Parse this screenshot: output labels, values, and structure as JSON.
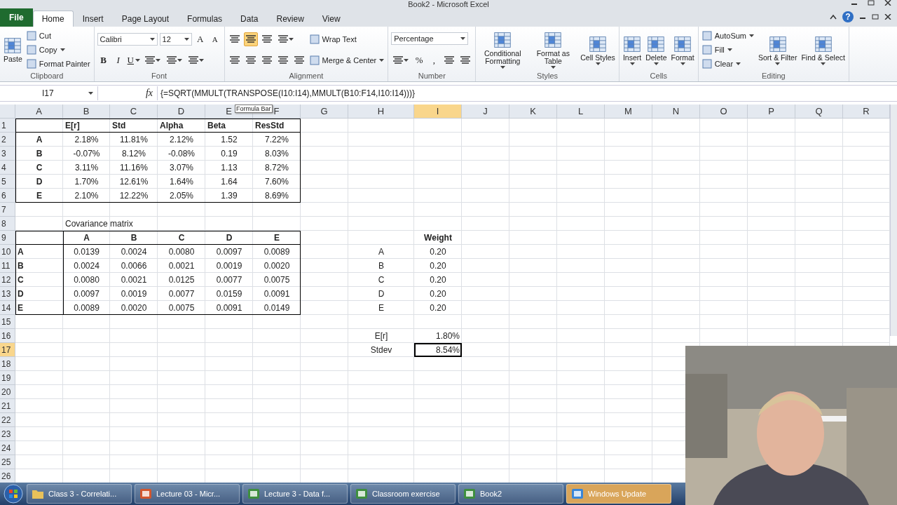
{
  "window": {
    "title": "Book2 - Microsoft Excel",
    "help": "?"
  },
  "tabs": [
    {
      "label": "File",
      "kind": "file",
      "selected": false
    },
    {
      "label": "Home",
      "kind": "tab",
      "selected": true
    },
    {
      "label": "Insert",
      "kind": "tab",
      "selected": false
    },
    {
      "label": "Page Layout",
      "kind": "tab",
      "selected": false
    },
    {
      "label": "Formulas",
      "kind": "tab",
      "selected": false
    },
    {
      "label": "Data",
      "kind": "tab",
      "selected": false
    },
    {
      "label": "Review",
      "kind": "tab",
      "selected": false
    },
    {
      "label": "View",
      "kind": "tab",
      "selected": false
    }
  ],
  "ribbon": [
    {
      "label": "Clipboard",
      "stacks": [
        [
          {
            "kind": "big",
            "label": "Paste"
          }
        ],
        [
          {
            "kind": "small",
            "label": "Cut"
          },
          {
            "kind": "small-menu",
            "label": "Copy"
          },
          {
            "kind": "small",
            "label": "Format Painter"
          }
        ]
      ]
    },
    {
      "label": "Font",
      "stacks": [
        [
          {
            "kind": "row",
            "items": [
              {
                "kind": "field",
                "label": "Calibri"
              },
              {
                "kind": "field",
                "label": "12"
              },
              {
                "kind": "char-grow",
                "label": "A"
              },
              {
                "kind": "char-shrink",
                "label": "A"
              }
            ]
          },
          {
            "kind": "row",
            "items": [
              {
                "kind": "char-bold",
                "label": "B"
              },
              {
                "kind": "char-italic",
                "label": "I"
              },
              {
                "kind": "char-underline",
                "label": "U"
              },
              {
                "kind": "tool-menu"
              },
              {
                "kind": "tool-menu"
              },
              {
                "kind": "tool-menu"
              }
            ]
          }
        ]
      ]
    },
    {
      "label": "Alignment",
      "stacks": [
        [
          {
            "kind": "row",
            "items": [
              {
                "kind": "tool",
                "selected": false
              },
              {
                "kind": "tool",
                "selected": true
              },
              {
                "kind": "tool",
                "selected": false
              },
              {
                "kind": "tool-menu",
                "selected": false
              }
            ]
          },
          {
            "kind": "row",
            "items": [
              {
                "kind": "tool"
              },
              {
                "kind": "tool"
              },
              {
                "kind": "tool"
              },
              {
                "kind": "tool"
              },
              {
                "kind": "tool"
              }
            ]
          }
        ],
        [
          {
            "kind": "small",
            "label": "Wrap Text"
          },
          {
            "kind": "small-menu",
            "label": "Merge & Center"
          }
        ]
      ]
    },
    {
      "label": "Number",
      "stacks": [
        [
          {
            "kind": "row",
            "items": [
              {
                "kind": "field",
                "label": "Percentage"
              }
            ]
          },
          {
            "kind": "row",
            "items": [
              {
                "kind": "tool-menu"
              },
              {
                "kind": "char",
                "label": "%"
              },
              {
                "kind": "char",
                "label": ","
              },
              {
                "kind": "tool"
              },
              {
                "kind": "tool"
              }
            ]
          }
        ]
      ]
    },
    {
      "label": "Styles",
      "stacks": [
        [
          {
            "kind": "big-menu",
            "label": "Conditional Formatting"
          }
        ],
        [
          {
            "kind": "big-menu",
            "label": "Format as Table"
          }
        ],
        [
          {
            "kind": "big-menu",
            "label": "Cell Styles"
          }
        ]
      ]
    },
    {
      "label": "Cells",
      "stacks": [
        [
          {
            "kind": "big-menu",
            "label": "Insert"
          }
        ],
        [
          {
            "kind": "big-menu",
            "label": "Delete"
          }
        ],
        [
          {
            "kind": "big-menu",
            "label": "Format"
          }
        ]
      ]
    },
    {
      "label": "Editing",
      "stacks": [
        [
          {
            "kind": "small-menu",
            "label": "AutoSum"
          },
          {
            "kind": "small-menu",
            "label": "Fill"
          },
          {
            "kind": "small-menu",
            "label": "Clear"
          }
        ],
        [
          {
            "kind": "big-menu",
            "label": "Sort & Filter"
          }
        ],
        [
          {
            "kind": "big-menu",
            "label": "Find & Select"
          }
        ]
      ]
    }
  ],
  "formula_bar": {
    "name_box": "I17",
    "function_button": "fx",
    "formula": "{=SQRT(MMULT(TRANSPOSE(I10:I14),MMULT(B10:F14,I10:I14)))}",
    "tooltip": "Formula Bar"
  },
  "sheet": {
    "columns": [
      {
        "label": "A",
        "selected": false
      },
      {
        "label": "B",
        "selected": false
      },
      {
        "label": "C",
        "selected": false
      },
      {
        "label": "D",
        "selected": false
      },
      {
        "label": "E",
        "selected": false
      },
      {
        "label": "F",
        "selected": false
      },
      {
        "label": "G",
        "selected": false
      },
      {
        "label": "H",
        "selected": false
      },
      {
        "label": "I",
        "selected": true
      },
      {
        "label": "J",
        "selected": false
      },
      {
        "label": "K",
        "selected": false
      },
      {
        "label": "L",
        "selected": false
      },
      {
        "label": "M",
        "selected": false
      },
      {
        "label": "N",
        "selected": false
      },
      {
        "label": "O",
        "selected": false
      },
      {
        "label": "P",
        "selected": false
      },
      {
        "label": "Q",
        "selected": false
      },
      {
        "label": "R",
        "selected": false
      }
    ],
    "rows": [
      {
        "label": "1",
        "selected": false
      },
      {
        "label": "2",
        "selected": false
      },
      {
        "label": "3",
        "selected": false
      },
      {
        "label": "4",
        "selected": false
      },
      {
        "label": "5",
        "selected": false
      },
      {
        "label": "6",
        "selected": false
      },
      {
        "label": "7",
        "selected": false
      },
      {
        "label": "8",
        "selected": false
      },
      {
        "label": "9",
        "selected": false
      },
      {
        "label": "10",
        "selected": false
      },
      {
        "label": "11",
        "selected": false
      },
      {
        "label": "12",
        "selected": false
      },
      {
        "label": "13",
        "selected": false
      },
      {
        "label": "14",
        "selected": false
      },
      {
        "label": "15",
        "selected": false
      },
      {
        "label": "16",
        "selected": false
      },
      {
        "label": "17",
        "selected": true
      },
      {
        "label": "18",
        "selected": false
      },
      {
        "label": "19",
        "selected": false
      },
      {
        "label": "20",
        "selected": false
      },
      {
        "label": "21",
        "selected": false
      },
      {
        "label": "22",
        "selected": false
      },
      {
        "label": "23",
        "selected": false
      },
      {
        "label": "24",
        "selected": false
      },
      {
        "label": "25",
        "selected": false
      },
      {
        "label": "26",
        "selected": false
      }
    ],
    "returns": {
      "headers": [
        "E[r]",
        "Std",
        "Alpha",
        "Beta",
        "ResStd"
      ],
      "rows": [
        {
          "name": "A",
          "values": [
            "2.18%",
            "11.81%",
            "2.12%",
            "1.52",
            "7.22%"
          ]
        },
        {
          "name": "B",
          "values": [
            "-0.07%",
            "8.12%",
            "-0.08%",
            "0.19",
            "8.03%"
          ]
        },
        {
          "name": "C",
          "values": [
            "3.11%",
            "11.16%",
            "3.07%",
            "1.13",
            "8.72%"
          ]
        },
        {
          "name": "D",
          "values": [
            "1.70%",
            "12.61%",
            "1.64%",
            "1.64",
            "7.60%"
          ]
        },
        {
          "name": "E",
          "values": [
            "2.10%",
            "12.22%",
            "2.05%",
            "1.39",
            "8.69%"
          ]
        }
      ]
    },
    "covariance": {
      "title": "Covariance matrix",
      "headers": [
        "A",
        "B",
        "C",
        "D",
        "E"
      ],
      "rows": [
        {
          "name": "A",
          "values": [
            "0.0139",
            "0.0024",
            "0.0080",
            "0.0097",
            "0.0089"
          ]
        },
        {
          "name": "B",
          "values": [
            "0.0024",
            "0.0066",
            "0.0021",
            "0.0019",
            "0.0020"
          ]
        },
        {
          "name": "C",
          "values": [
            "0.0080",
            "0.0021",
            "0.0125",
            "0.0077",
            "0.0075"
          ]
        },
        {
          "name": "D",
          "values": [
            "0.0097",
            "0.0019",
            "0.0077",
            "0.0159",
            "0.0091"
          ]
        },
        {
          "name": "E",
          "values": [
            "0.0089",
            "0.0020",
            "0.0075",
            "0.0091",
            "0.0149"
          ]
        }
      ]
    },
    "weights": {
      "header": "Weight",
      "rows": [
        {
          "name": "A",
          "value": "0.20"
        },
        {
          "name": "B",
          "value": "0.20"
        },
        {
          "name": "C",
          "value": "0.20"
        },
        {
          "name": "D",
          "value": "0.20"
        },
        {
          "name": "E",
          "value": "0.20"
        }
      ]
    },
    "summary": [
      {
        "label": "E[r]",
        "value": "1.80%",
        "selected": false
      },
      {
        "label": "Stdev",
        "value": "8.54%",
        "selected": true
      }
    ]
  },
  "taskbar": [
    {
      "label": "Class 3 - Correlati...",
      "kind": "folder",
      "highlighted": false
    },
    {
      "label": "Lecture 03 - Micr...",
      "kind": "slides",
      "highlighted": false
    },
    {
      "label": "Lecture 3 - Data f...",
      "kind": "sheet",
      "highlighted": false
    },
    {
      "label": "Classroom exercise",
      "kind": "sheet",
      "highlighted": false
    },
    {
      "label": "Book2",
      "kind": "sheet",
      "highlighted": false
    },
    {
      "label": "Windows Update",
      "kind": "update",
      "highlighted": true
    }
  ]
}
